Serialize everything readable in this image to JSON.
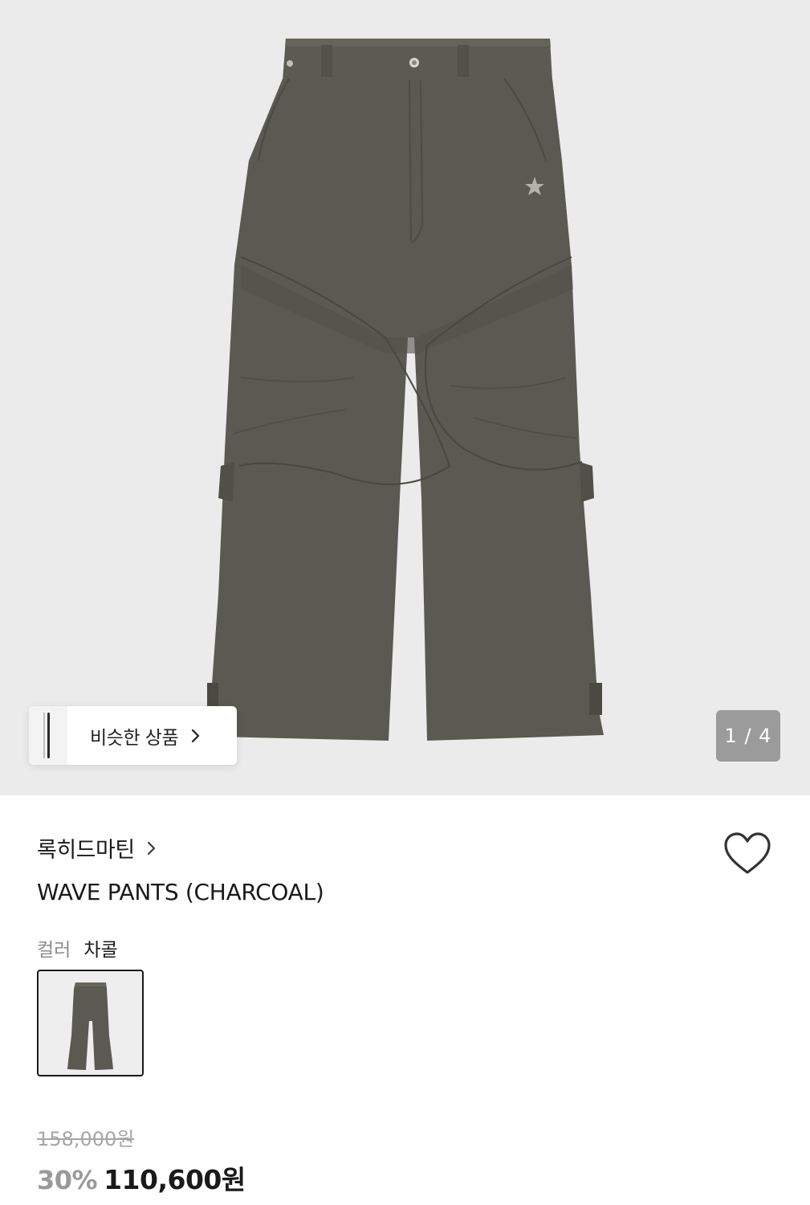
{
  "gallery": {
    "image_alt": "WAVE PANTS (CHARCOAL) product photo",
    "counter": "1 / 4",
    "similar_label": "비슷한 상품"
  },
  "product": {
    "brand": "록히드마틴",
    "title": "WAVE PANTS (CHARCOAL)",
    "color_label": "컬러",
    "color_value": "차콜",
    "original_price": "158,000원",
    "discount": "30%",
    "sale_price": "110,600원"
  },
  "icons": {
    "similar_chevron": "chevron-right-icon",
    "brand_chevron": "chevron-right-icon",
    "wishlist": "heart-outline-icon"
  },
  "colors": {
    "hero_bg": "#ebebeb",
    "pants": "#5a5a52",
    "text_primary": "#1a1a1a",
    "text_muted": "#8c8c8c",
    "discount": "#9a9a9a"
  }
}
